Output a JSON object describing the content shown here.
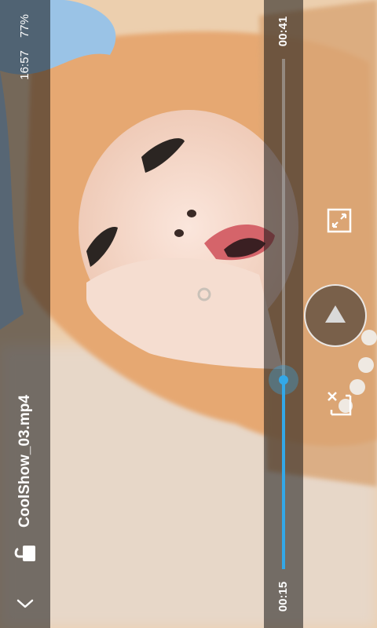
{
  "video": {
    "title": "CoolShow_03.mp4"
  },
  "status_bar": {
    "time": "16:57",
    "battery": "77%"
  },
  "playback": {
    "current_time": "00:15",
    "total_time": "00:41",
    "progress_fraction": 0.37,
    "state": "paused"
  },
  "icons": {
    "back": "chevron-down-icon",
    "lock": "unlock-icon",
    "crop": "crop-icon",
    "play": "play-icon",
    "fullscreen": "fullscreen-icon"
  },
  "colors": {
    "accent": "#33a8e8",
    "bar_background": "#141414"
  },
  "orientation": "landscape-rotated"
}
